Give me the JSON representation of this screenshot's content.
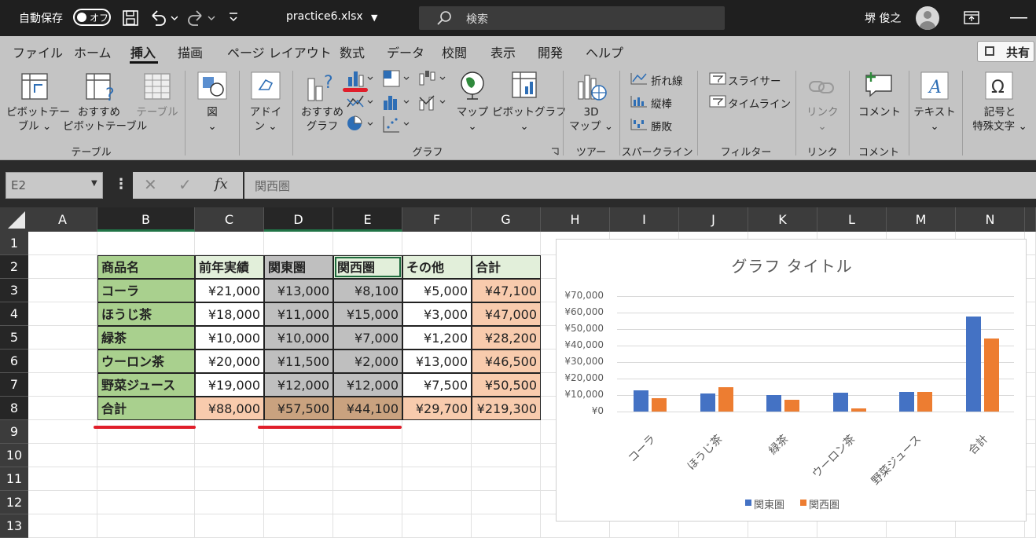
{
  "titlebar": {
    "autosave_label": "自動保存",
    "autosave_state": "オフ",
    "filename": "practice6.xlsx",
    "search_placeholder": "検索",
    "user_name": "堺 俊之"
  },
  "menu": {
    "tabs": [
      "ファイル",
      "ホーム",
      "挿入",
      "描画",
      "ページ レイアウト",
      "数式",
      "データ",
      "校閲",
      "表示",
      "開発",
      "ヘルプ"
    ],
    "active_tab": "挿入",
    "share_label": "共有"
  },
  "ribbon": {
    "pivot_table": [
      "ピボットテー",
      "ブル ⌄"
    ],
    "recommended_pivot": [
      "おすすめ",
      "ピボットテーブル"
    ],
    "table": "テーブル",
    "illustrations": [
      "図",
      "⌄"
    ],
    "addins": [
      "アドイ",
      "ン ⌄"
    ],
    "recommended_charts": [
      "おすすめ",
      "グラフ"
    ],
    "maps": [
      "マップ",
      "⌄"
    ],
    "pivot_chart": [
      "ピボットグラフ",
      "⌄"
    ],
    "map3d": [
      "3D",
      "マップ ⌄"
    ],
    "spark_line": "折れ線",
    "spark_column": "縦棒",
    "spark_winloss": "勝敗",
    "slicer": "スライサー",
    "timeline": "タイムライン",
    "link": [
      "リンク",
      "⌄"
    ],
    "comment": "コメント",
    "text": [
      "テキスト",
      "⌄"
    ],
    "symbols": [
      "記号と",
      "特殊文字 ⌄"
    ],
    "groups": [
      "テーブル",
      "グラフ",
      "ツアー",
      "スパークライン",
      "フィルター",
      "リンク",
      "コメント"
    ]
  },
  "formula_bar": {
    "name_box": "E2",
    "formula": "関西圏"
  },
  "columns": [
    "A",
    "B",
    "C",
    "D",
    "E",
    "F",
    "G",
    "H",
    "I",
    "J",
    "K",
    "L",
    "M",
    "N"
  ],
  "rows": [
    "1",
    "2",
    "3",
    "4",
    "5",
    "6",
    "7",
    "8",
    "9",
    "10",
    "11",
    "12",
    "13"
  ],
  "table": {
    "headers": [
      "商品名",
      "前年実績",
      "関東圏",
      "関西圏",
      "その他",
      "合計"
    ],
    "rows": [
      [
        "コーラ",
        "¥21,000",
        "¥13,000",
        "¥8,100",
        "¥5,000",
        "¥47,100"
      ],
      [
        "ほうじ茶",
        "¥18,000",
        "¥11,000",
        "¥15,000",
        "¥3,000",
        "¥47,000"
      ],
      [
        "緑茶",
        "¥10,000",
        "¥10,000",
        "¥7,000",
        "¥1,200",
        "¥28,200"
      ],
      [
        "ウーロン茶",
        "¥20,000",
        "¥11,500",
        "¥2,000",
        "¥13,000",
        "¥46,500"
      ],
      [
        "野菜ジュース",
        "¥19,000",
        "¥12,000",
        "¥12,000",
        "¥7,500",
        "¥50,500"
      ],
      [
        "合計",
        "¥88,000",
        "¥57,500",
        "¥44,100",
        "¥29,700",
        "¥219,300"
      ]
    ]
  },
  "colors": {
    "green_fill": "#a9d08e",
    "light_green": "#e2efda",
    "gray_fill": "#bfbfbf",
    "orange_fill": "#f8cbad",
    "brown_fill": "#c9a27f",
    "series1": "#4472c4",
    "series2": "#ed7d31",
    "annotation_red": "#e01e2a"
  },
  "chart_data": {
    "type": "bar",
    "title": "グラフ タイトル",
    "categories": [
      "コーラ",
      "ほうじ茶",
      "緑茶",
      "ウーロン茶",
      "野菜ジュース",
      "合計"
    ],
    "series": [
      {
        "name": "関東圏",
        "values": [
          13000,
          11000,
          10000,
          11500,
          12000,
          57500
        ]
      },
      {
        "name": "関西圏",
        "values": [
          8100,
          15000,
          7000,
          2000,
          12000,
          44100
        ]
      }
    ],
    "ylim": [
      0,
      70000
    ],
    "yticks": [
      "¥70,000",
      "¥60,000",
      "¥50,000",
      "¥40,000",
      "¥30,000",
      "¥20,000",
      "¥10,000",
      "¥0"
    ],
    "grid": true,
    "legend": "bottom"
  }
}
